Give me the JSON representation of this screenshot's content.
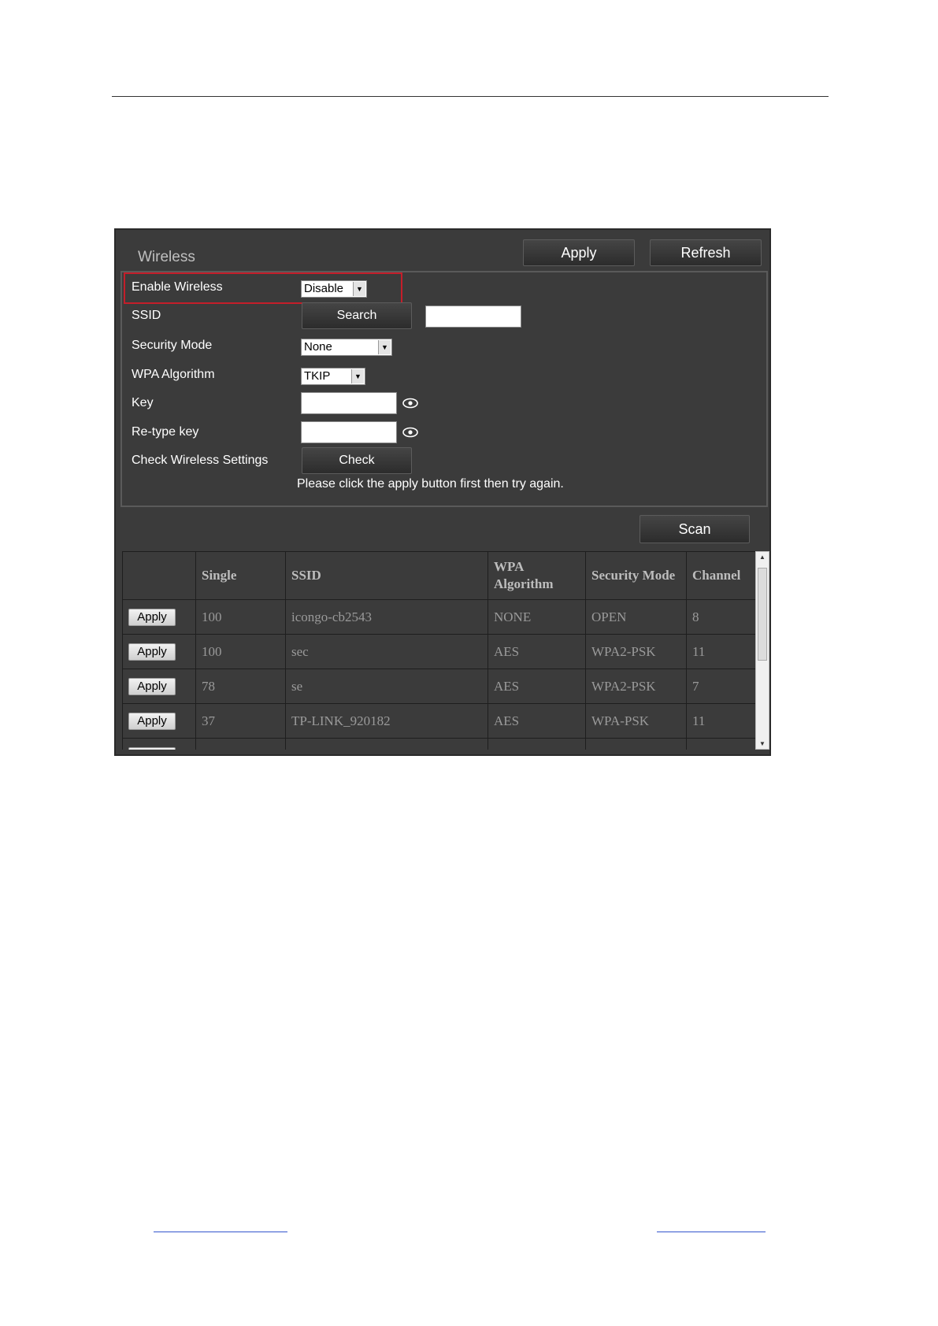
{
  "panel": {
    "title": "Wireless",
    "apply_label": "Apply",
    "refresh_label": "Refresh"
  },
  "settings": {
    "enable_wireless": {
      "label": "Enable Wireless",
      "value": "Disable"
    },
    "ssid": {
      "label": "SSID",
      "search_label": "Search",
      "value": ""
    },
    "security_mode": {
      "label": "Security Mode",
      "value": "None"
    },
    "wpa_algorithm": {
      "label": "WPA Algorithm",
      "value": "TKIP"
    },
    "key": {
      "label": "Key",
      "value": ""
    },
    "retype_key": {
      "label": "Re-type key",
      "value": ""
    },
    "check_wireless": {
      "label": "Check Wireless Settings",
      "check_label": "Check"
    },
    "hint": "Please click the apply button first then try again."
  },
  "scan_label": "Scan",
  "table": {
    "headers": [
      "",
      "Single",
      "SSID",
      "WPA Algorithm",
      "Security Mode",
      "Channel"
    ],
    "rows": [
      {
        "action": "Apply",
        "signal": "100",
        "ssid": "icongo-cb2543",
        "wpa": "NONE",
        "security": "OPEN",
        "channel": "8"
      },
      {
        "action": "Apply",
        "signal": "100",
        "ssid": "sec",
        "wpa": "AES",
        "security": "WPA2-PSK",
        "channel": "11"
      },
      {
        "action": "Apply",
        "signal": "78",
        "ssid": "se",
        "wpa": "AES",
        "security": "WPA2-PSK",
        "channel": "7"
      },
      {
        "action": "Apply",
        "signal": "37",
        "ssid": "TP-LINK_920182",
        "wpa": "AES",
        "security": "WPA-PSK",
        "channel": "11"
      }
    ]
  },
  "colors": {
    "panel_bg": "#3b3b3b",
    "highlight": "#c41e2a"
  }
}
